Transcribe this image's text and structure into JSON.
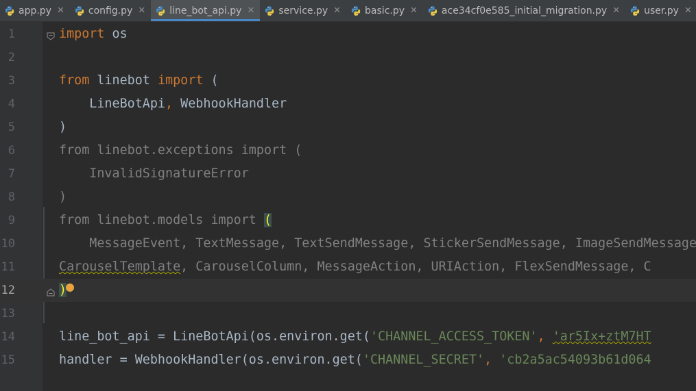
{
  "tabs": [
    {
      "label": "app.py",
      "active": false
    },
    {
      "label": "config.py",
      "active": false
    },
    {
      "label": "line_bot_api.py",
      "active": true
    },
    {
      "label": "service.py",
      "active": false
    },
    {
      "label": "basic.py",
      "active": false
    },
    {
      "label": "ace34cf0e585_initial_migration.py",
      "active": false
    },
    {
      "label": "user.py",
      "active": false
    }
  ],
  "icons": {
    "tab_file": "python-file-icon",
    "tab_close": "close-icon",
    "fold": "fold-marker-icon",
    "bulb": "lightbulb-icon"
  },
  "colors": {
    "keyword": "#cc7832",
    "string": "#6a8759",
    "unused": "#808080",
    "text": "#a9b7c6",
    "background": "#2b2b2b"
  },
  "editor": {
    "current_line": 12,
    "lines": [
      {
        "number": "1",
        "tokens": [
          {
            "t": "import",
            "c": "kw"
          },
          {
            "t": " os",
            "c": ""
          }
        ]
      },
      {
        "number": "2",
        "tokens": []
      },
      {
        "number": "3",
        "tokens": [
          {
            "t": "from",
            "c": "kw"
          },
          {
            "t": " linebot ",
            "c": ""
          },
          {
            "t": "import",
            "c": "kw"
          },
          {
            "t": " (",
            "c": ""
          }
        ]
      },
      {
        "number": "4",
        "tokens": [
          {
            "t": "    LineBotApi",
            "c": ""
          },
          {
            "t": ",",
            "c": "kw"
          },
          {
            "t": " WebhookHandler",
            "c": ""
          }
        ]
      },
      {
        "number": "5",
        "tokens": [
          {
            "t": ")",
            "c": ""
          }
        ]
      },
      {
        "number": "6",
        "tokens": [
          {
            "t": "from linebot.exceptions import (",
            "c": "dim"
          }
        ]
      },
      {
        "number": "7",
        "tokens": [
          {
            "t": "    InvalidSignatureError",
            "c": "dim"
          }
        ]
      },
      {
        "number": "8",
        "tokens": [
          {
            "t": ")",
            "c": "dim"
          }
        ]
      },
      {
        "number": "9",
        "tokens": [
          {
            "t": "from linebot.models import ",
            "c": "dim"
          },
          {
            "t": "(",
            "c": "paren-hl"
          }
        ]
      },
      {
        "number": "10",
        "tokens": [
          {
            "t": "    MessageEvent, TextMessage, TextSendMessage, StickerSendMessage, ImageSendMessage,",
            "c": "dim"
          }
        ]
      },
      {
        "number": "11",
        "tokens": [
          {
            "t": "CarouselTemplate",
            "c": "dim squiggle"
          },
          {
            "t": ", CarouselColumn, MessageAction, URIAction, FlexSendMessage, C",
            "c": "dim"
          }
        ]
      },
      {
        "number": "12",
        "tokens": [
          {
            "t": ")",
            "c": "paren-hl"
          }
        ]
      },
      {
        "number": "13",
        "tokens": []
      },
      {
        "number": "14",
        "tokens": [
          {
            "t": "line_bot_api = LineBotApi(os.environ.get(",
            "c": ""
          },
          {
            "t": "'CHANNEL_ACCESS_TOKEN'",
            "c": "str"
          },
          {
            "t": ", ",
            "c": "kw"
          },
          {
            "t": "'ar5Ix+ztM7HT",
            "c": "str squiggle"
          }
        ]
      },
      {
        "number": "15",
        "tokens": [
          {
            "t": "handler = WebhookHandler(os.environ.get(",
            "c": ""
          },
          {
            "t": "'CHANNEL_SECRET'",
            "c": "str"
          },
          {
            "t": ", ",
            "c": "kw"
          },
          {
            "t": "'cb2a5ac54093b61d064",
            "c": "str"
          }
        ]
      }
    ]
  }
}
